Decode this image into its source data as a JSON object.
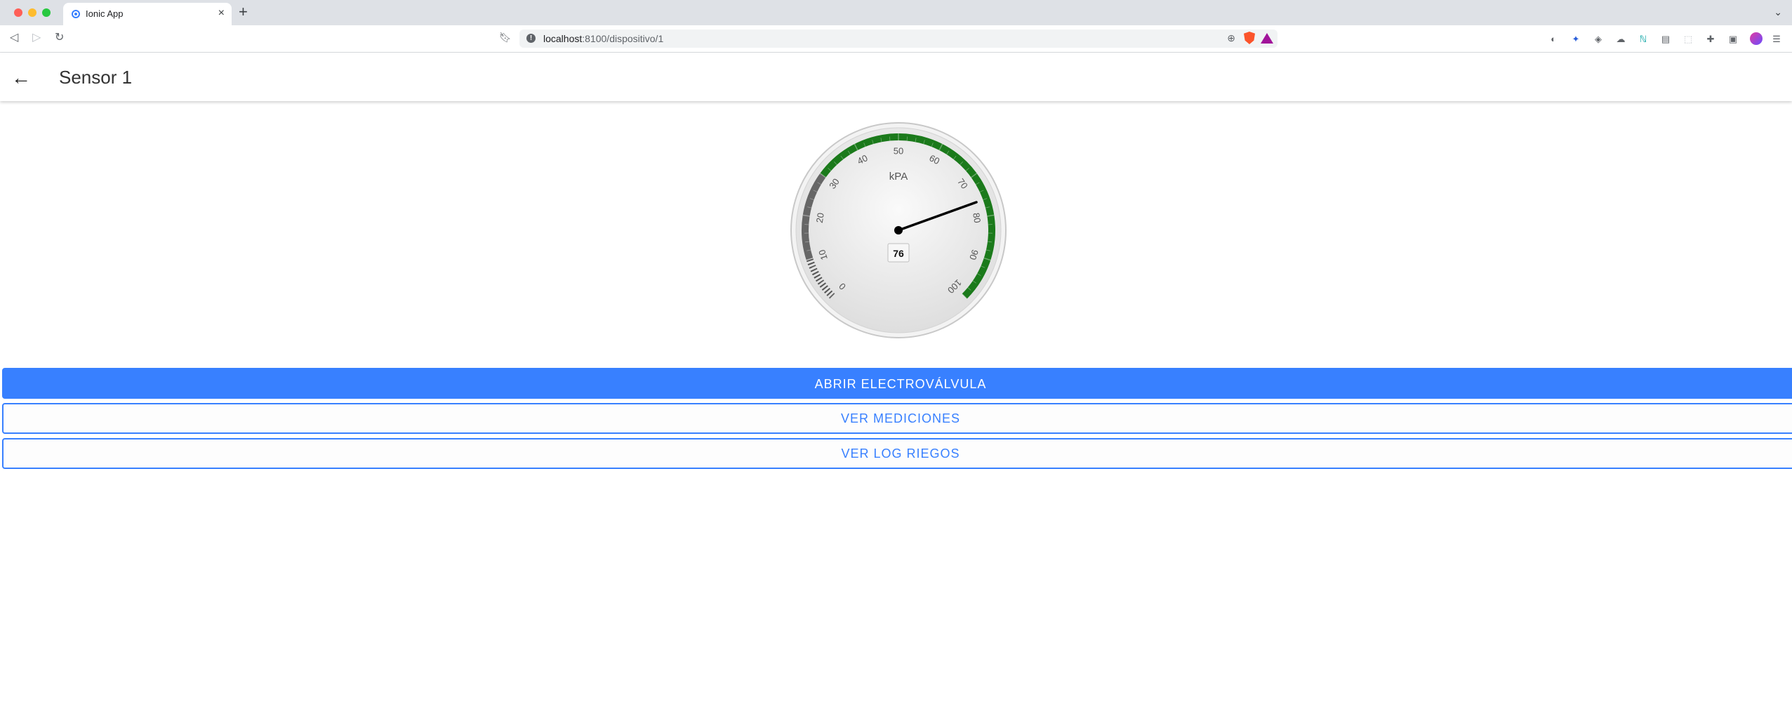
{
  "browser": {
    "tab": {
      "title": "Ionic App"
    },
    "address": {
      "host": "localhost",
      "path": ":8100/dispositivo/1"
    }
  },
  "app": {
    "title": "Sensor 1"
  },
  "gauge": {
    "unit": "kPA",
    "value": 76,
    "value_label": "76",
    "min": 0,
    "max": 100,
    "ticks": [
      "0",
      "10",
      "20",
      "30",
      "40",
      "50",
      "60",
      "70",
      "80",
      "90",
      "100"
    ],
    "bands": [
      {
        "from": 0,
        "to": 10,
        "color": "#555555",
        "style": "dashed"
      },
      {
        "from": 10,
        "to": 30,
        "color": "#666666"
      },
      {
        "from": 30,
        "to": 100,
        "color": "#1b7a1b"
      }
    ],
    "colors": {
      "face": "#ececec",
      "needle": "#000000"
    }
  },
  "buttons": {
    "open_valve": "ABRIR ELECTROVÁLVULA",
    "measurements": "VER MEDICIONES",
    "irrigation_log": "VER LOG RIEGOS"
  },
  "colors": {
    "primary": "#3880ff"
  }
}
